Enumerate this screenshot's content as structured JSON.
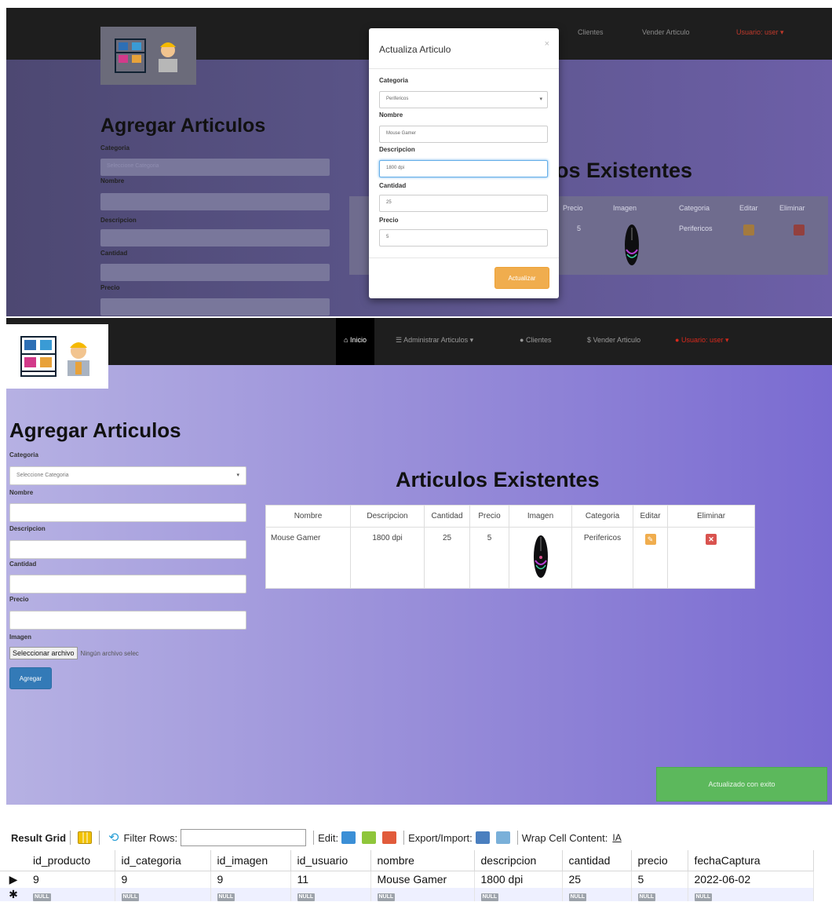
{
  "panel1": {
    "bg_title": "Agregar Articulos",
    "bg_labels": [
      "Categoria",
      "Nombre",
      "Descripcion",
      "Cantidad",
      "Precio"
    ],
    "bg_select": "Seleccione Categoria",
    "bg_exist_title": "os Existentes",
    "bg_table_headers": [
      "Precio",
      "Imagen",
      "Categoria",
      "Editar",
      "Eliminar"
    ],
    "bg_row": {
      "precio": "5",
      "categoria": "Perifericos"
    },
    "modal": {
      "title": "Actualiza Articulo",
      "close": "×",
      "categoria_label": "Categoria",
      "categoria_value": "Perifericos",
      "nombre_label": "Nombre",
      "nombre_value": "Mouse Gamer",
      "descripcion_label": "Descripcion",
      "descripcion_value": "1800 dpi",
      "cantidad_label": "Cantidad",
      "cantidad_value": "25",
      "precio_label": "Precio",
      "precio_value": "5",
      "submit_label": "Actualizar"
    }
  },
  "nav": {
    "inicio": "Inicio",
    "administrar": "Administrar Articulos ▾",
    "clientes": "Clientes",
    "vender": "Vender Articulo",
    "usuario": "Usuario: user ▾"
  },
  "form": {
    "title": "Agregar Articulos",
    "categoria_label": "Categoria",
    "categoria_placeholder": "Seleccione Categoria",
    "nombre_label": "Nombre",
    "descripcion_label": "Descripcion",
    "cantidad_label": "Cantidad",
    "precio_label": "Precio",
    "imagen_label": "Imagen",
    "file_button": "Seleccionar archivo",
    "file_status": "Ningún archivo selec",
    "submit_label": "Agregar"
  },
  "table": {
    "title": "Articulos Existentes",
    "headers": [
      "Nombre",
      "Descripcion",
      "Cantidad",
      "Precio",
      "Imagen",
      "Categoria",
      "Editar",
      "Eliminar"
    ],
    "rows": [
      {
        "nombre": "Mouse Gamer",
        "descripcion": "1800 dpi",
        "cantidad": "25",
        "precio": "5",
        "categoria": "Perifericos"
      }
    ]
  },
  "toast": "Actualizado con exito",
  "result_grid": {
    "toolbar": {
      "result_grid": "Result Grid",
      "filter_rows": "Filter Rows:",
      "edit": "Edit:",
      "export_import": "Export/Import:",
      "wrap": "Wrap Cell Content:"
    },
    "columns": [
      "id_producto",
      "id_categoria",
      "id_imagen",
      "id_usuario",
      "nombre",
      "descripcion",
      "cantidad",
      "precio",
      "fechaCaptura"
    ],
    "rows": [
      [
        "9",
        "9",
        "9",
        "11",
        "Mouse Gamer",
        "1800 dpi",
        "25",
        "5",
        "2022-06-02"
      ]
    ],
    "null_label": "NULL"
  },
  "colors": {
    "navbar": "#1e1e1e",
    "warning": "#f0ad4e",
    "danger": "#d9534f",
    "primary": "#337ab7",
    "success": "#5cb85c"
  }
}
